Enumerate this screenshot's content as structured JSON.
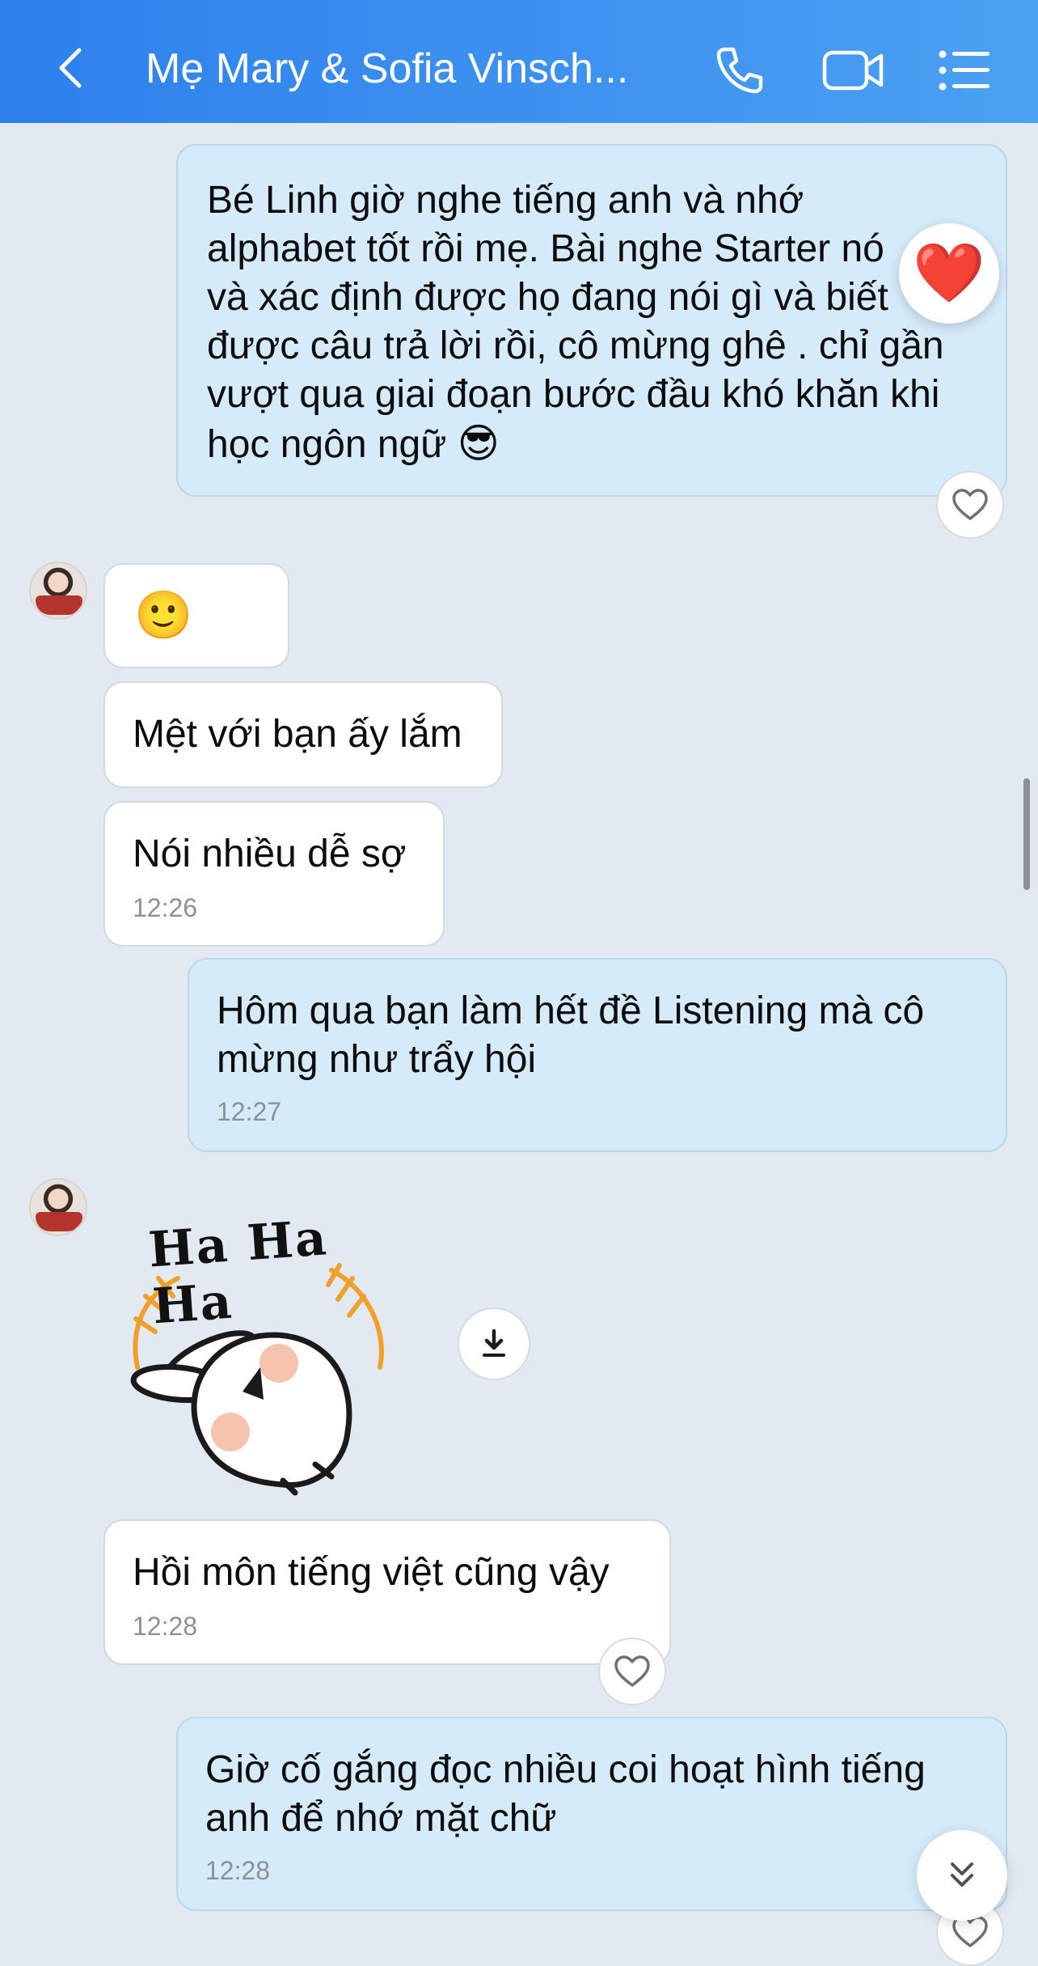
{
  "header": {
    "title": "Mẹ Mary & Sofia Vinsch...",
    "back_icon": "chevron-left-icon",
    "call_icon": "phone-icon",
    "video_icon": "video-camera-icon",
    "menu_icon": "list-menu-icon",
    "colors": {
      "gradient_start": "#2d80ec",
      "gradient_end": "#4ba1f2"
    }
  },
  "messages": [
    {
      "id": "m1",
      "sender": "me",
      "text": "Bé Linh giờ nghe tiếng anh và nhớ\nalphabet tốt rồi mẹ. Bài nghe Starter nó\nvà xác định được họ đang nói gì và  biết\nđược câu trả lời rồi, cô mừng ghê . chỉ gần\nvượt qua giai đoạn bước đầu khó khăn khi\nhọc ngôn ngữ",
      "emoji": "😎",
      "reaction": "❤️"
    },
    {
      "id": "m2",
      "sender": "them",
      "emoji": "🙂"
    },
    {
      "id": "m3",
      "sender": "them",
      "text": "Mệt với bạn ấy lắm"
    },
    {
      "id": "m4",
      "sender": "them",
      "text": "Nói nhiều dễ sợ",
      "time": "12:26"
    },
    {
      "id": "m5",
      "sender": "me",
      "text": "Hôm qua bạn làm hết đề Listening mà cô\nmừng như trẩy hội",
      "time": "12:27"
    },
    {
      "id": "m6",
      "sender": "them",
      "sticker_text": "Ha Ha Ha"
    },
    {
      "id": "m7",
      "sender": "them",
      "text": "Hồi môn tiếng việt cũng vậy",
      "time": "12:28"
    },
    {
      "id": "m8",
      "sender": "me",
      "text": "Giờ cố gắng đọc nhiều coi hoạt hình tiếng\nanh để nhớ mặt chữ",
      "time": "12:28"
    }
  ],
  "colors": {
    "background": "#e2e9f1",
    "my_bubble": "#d5ebfa",
    "their_bubble": "#ffffff"
  }
}
